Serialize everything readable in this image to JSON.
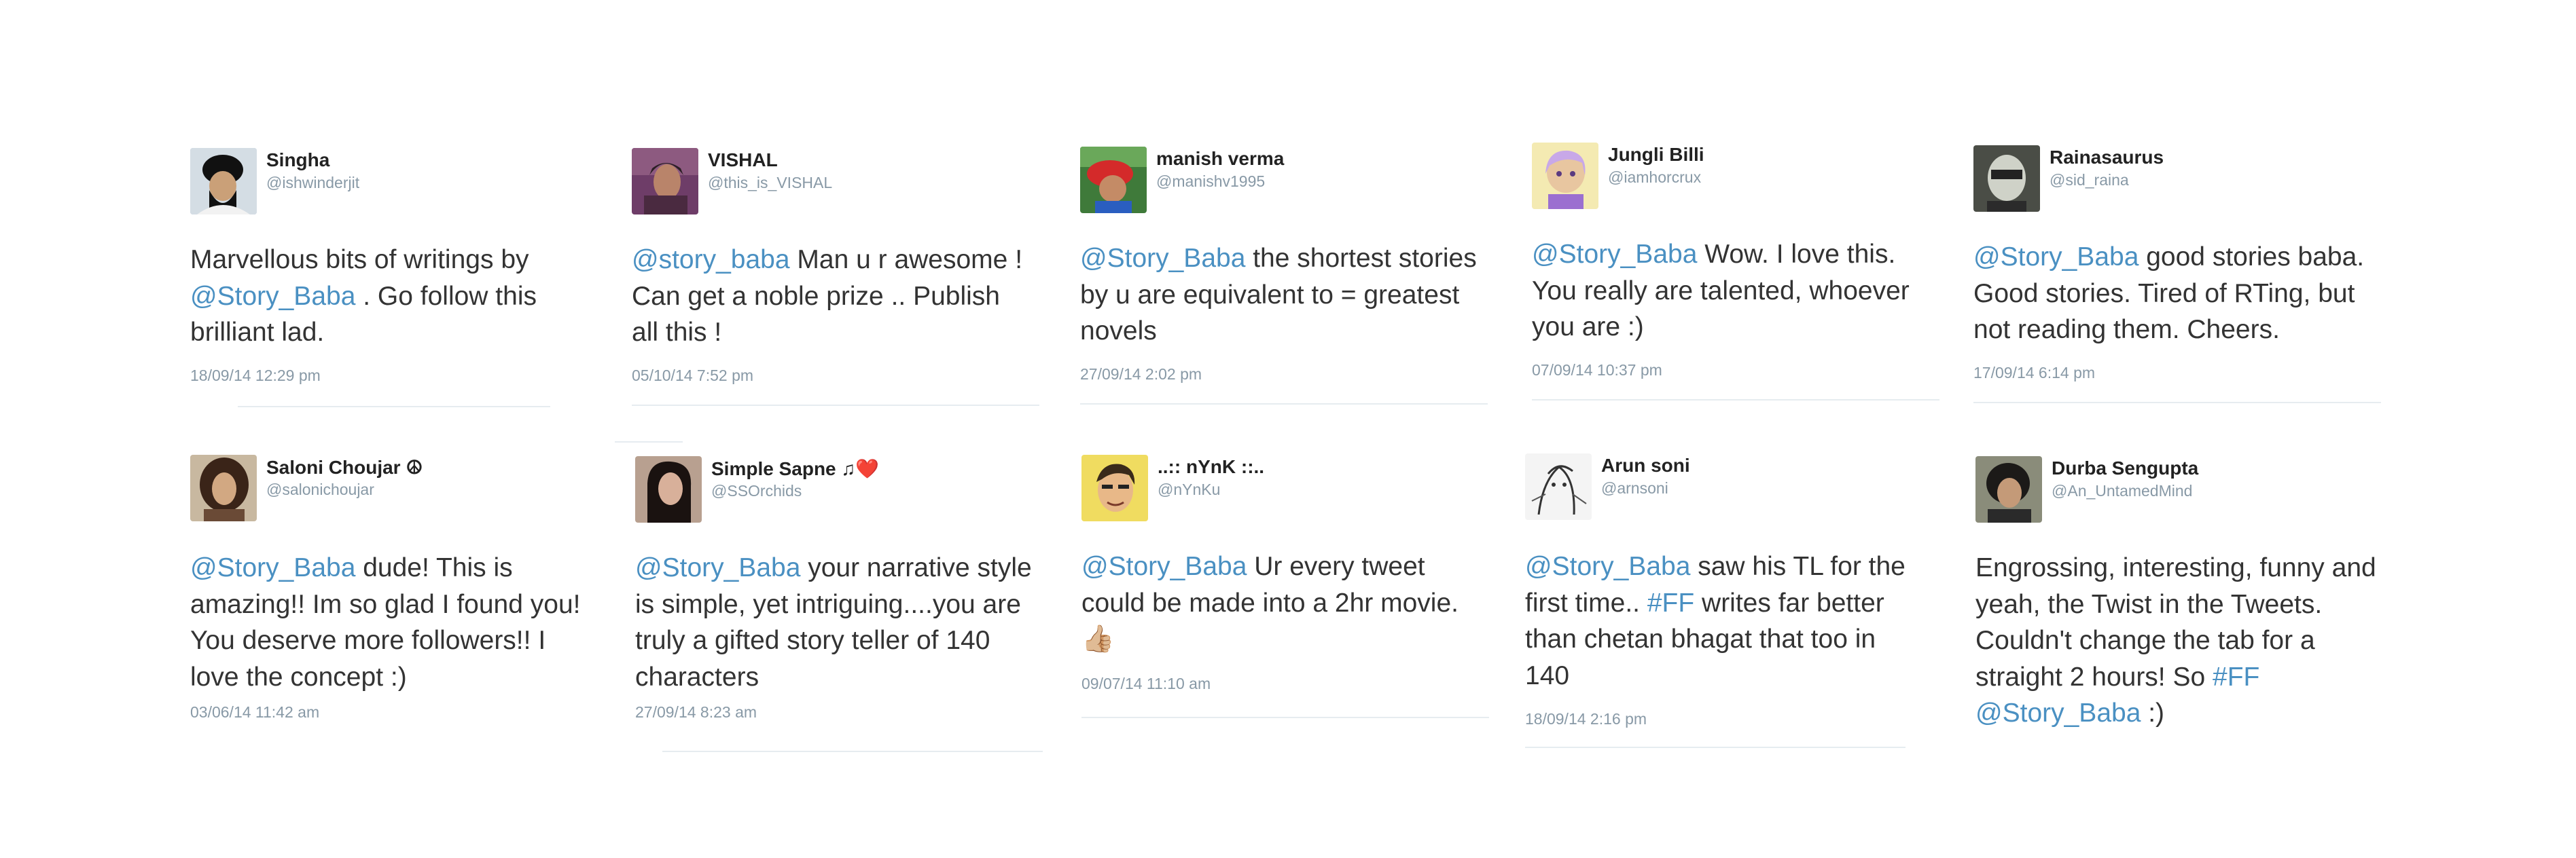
{
  "tweets": [
    {
      "name": "Singha",
      "handle": "@ishwinderjit",
      "text": [
        {
          "t": "text",
          "v": "Marvellous bits of writings by "
        },
        {
          "t": "mention",
          "v": "@Story_Baba"
        },
        {
          "t": "text",
          "v": " . Go follow this brilliant lad."
        }
      ],
      "date": "18/09/14 12:29 pm",
      "avatar": "person-turban-avatar"
    },
    {
      "name": "VISHAL",
      "handle": "@this_is_VISHAL",
      "text": [
        {
          "t": "mention",
          "v": "@story_baba"
        },
        {
          "t": "text",
          "v": " Man u r awesome ! Can get a noble prize .. Publish all this !"
        }
      ],
      "date": "05/10/14 7:52 pm",
      "avatar": "purple-portrait-avatar"
    },
    {
      "name": "manish verma",
      "handle": "@manishv1995",
      "text": [
        {
          "t": "mention",
          "v": "@Story_Baba"
        },
        {
          "t": "text",
          "v": "  the shortest stories by u are equivalent to = greatest novels"
        }
      ],
      "date": "27/09/14 2:02 pm",
      "avatar": "red-cap-avatar"
    },
    {
      "name": "Jungli Billi",
      "handle": "@iamhorcrux",
      "text": [
        {
          "t": "mention",
          "v": "@Story_Baba"
        },
        {
          "t": "text",
          "v": " Wow. I love this. You really are talented, whoever you are :)"
        }
      ],
      "date": "07/09/14 10:37 pm",
      "avatar": "girl-illustration-avatar"
    },
    {
      "name": "Rainasaurus",
      "handle": "@sid_raina",
      "text": [
        {
          "t": "mention",
          "v": "@Story_Baba"
        },
        {
          "t": "text",
          "v": " good stories baba. Good stories. Tired of RTing, but not reading them. Cheers."
        }
      ],
      "date": "17/09/14 6:14 pm",
      "avatar": "masked-face-avatar"
    },
    {
      "name": "Saloni Choujar ☮",
      "handle": "@salonichoujar",
      "text": [
        {
          "t": "mention",
          "v": "@Story_Baba"
        },
        {
          "t": "text",
          "v": " dude! This is amazing!! Im so glad I found you! You deserve more followers!! I love the concept :)"
        }
      ],
      "date": "03/06/14 11:42 am",
      "avatar": "curly-hair-avatar"
    },
    {
      "name": "Simple Sapne ♫❤️",
      "handle": "@SSOrchids",
      "text": [
        {
          "t": "mention",
          "v": "@Story_Baba"
        },
        {
          "t": "text",
          "v": "  your narrative style is simple, yet intriguing....you are truly a  gifted story teller of 140 characters"
        }
      ],
      "date": "27/09/14 8:23 am",
      "avatar": "dark-hair-avatar"
    },
    {
      "name": "..:: nYnK ::..",
      "handle": "@nYnKu",
      "text": [
        {
          "t": "mention",
          "v": "@Story_Baba"
        },
        {
          "t": "text",
          "v": "  Ur every tweet could be made into a 2hr movie. 👍🏼"
        }
      ],
      "date": "09/07/14 11:10 am",
      "avatar": "cartoon-face-avatar"
    },
    {
      "name": "Arun soni",
      "handle": "@arnsoni",
      "text": [
        {
          "t": "mention",
          "v": "@Story_Baba"
        },
        {
          "t": "text",
          "v": " saw his TL for the first time.. "
        },
        {
          "t": "hashtag",
          "v": "#FF"
        },
        {
          "t": "text",
          "v": " writes far better than chetan bhagat that too in 140"
        }
      ],
      "date": "18/09/14 2:16 pm",
      "avatar": "sketch-avatar"
    },
    {
      "name": "Durba Sengupta",
      "handle": "@An_UntamedMind",
      "text": [
        {
          "t": "text",
          "v": "Engrossing, interesting, funny and yeah, the Twist in the Tweets. Couldn't change the tab for a straight 2 hours! So "
        },
        {
          "t": "hashtag",
          "v": "#FF"
        },
        {
          "t": "text",
          "v": " "
        },
        {
          "t": "mention",
          "v": "@Story_Baba"
        },
        {
          "t": "text",
          "v": " :)"
        }
      ],
      "date": "",
      "avatar": "short-hair-woman-avatar"
    }
  ]
}
